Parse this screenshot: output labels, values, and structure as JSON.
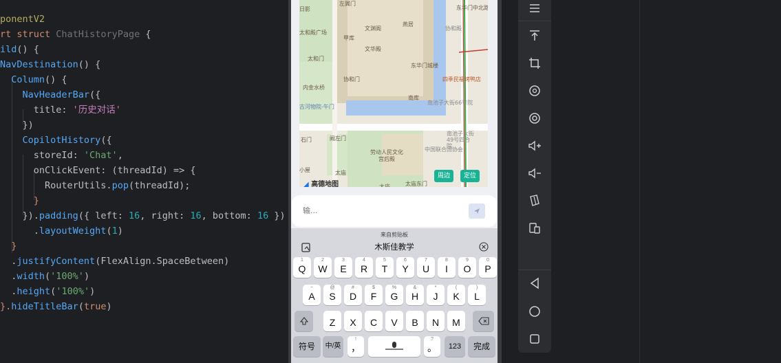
{
  "editor": {
    "lines": [
      [
        {
          "t": "ponentV2",
          "c": "dec"
        }
      ],
      [
        {
          "t": "rt ",
          "c": "kw"
        },
        {
          "t": "struct ",
          "c": "kw"
        },
        {
          "t": "ChatHistoryPage",
          "c": "cls"
        },
        {
          "t": " {",
          "c": "plain"
        }
      ],
      [
        {
          "t": "ild",
          "c": "fn"
        },
        {
          "t": "() {",
          "c": "plain"
        }
      ],
      [
        {
          "t": "NavDestination",
          "c": "fn"
        },
        {
          "t": "() {",
          "c": "plain"
        }
      ],
      [
        {
          "t": "  Column",
          "c": "fn"
        },
        {
          "t": "() {",
          "c": "plain"
        }
      ],
      [
        {
          "t": "    NavHeaderBar",
          "c": "fn"
        },
        {
          "t": "({",
          "c": "plain"
        }
      ],
      [
        {
          "t": "      title: ",
          "c": "plain"
        },
        {
          "t": "'历史对话'",
          "c": "strp"
        }
      ],
      [
        {
          "t": "    })",
          "c": "plain"
        }
      ],
      [
        {
          "t": "    CopilotHistory",
          "c": "fn"
        },
        {
          "t": "({",
          "c": "plain"
        }
      ],
      [
        {
          "t": "      storeId: ",
          "c": "plain"
        },
        {
          "t": "'Chat'",
          "c": "str"
        },
        {
          "t": ",",
          "c": "plain"
        }
      ],
      [
        {
          "t": "      onClickEvent: (",
          "c": "plain"
        },
        {
          "t": "threadId",
          "c": "plain"
        },
        {
          "t": ") => {",
          "c": "plain"
        }
      ],
      [
        {
          "t": "        RouterUtils.",
          "c": "plain"
        },
        {
          "t": "pop",
          "c": "fn"
        },
        {
          "t": "(threadId);",
          "c": "plain"
        }
      ],
      [
        {
          "t": "      }",
          "c": "kw"
        }
      ],
      [
        {
          "t": "    }).",
          "c": "plain"
        },
        {
          "t": "padding",
          "c": "fn"
        },
        {
          "t": "({ left: ",
          "c": "plain"
        },
        {
          "t": "16",
          "c": "num"
        },
        {
          "t": ", right: ",
          "c": "plain"
        },
        {
          "t": "16",
          "c": "num"
        },
        {
          "t": ", bottom: ",
          "c": "plain"
        },
        {
          "t": "16",
          "c": "num"
        },
        {
          "t": " })",
          "c": "plain"
        }
      ],
      [
        {
          "t": "      .",
          "c": "plain"
        },
        {
          "t": "layoutWeight",
          "c": "fn"
        },
        {
          "t": "(",
          "c": "plain"
        },
        {
          "t": "1",
          "c": "num"
        },
        {
          "t": ")",
          "c": "plain"
        }
      ],
      [
        {
          "t": "  }",
          "c": "kw"
        }
      ],
      [
        {
          "t": "  .",
          "c": "plain"
        },
        {
          "t": "justifyContent",
          "c": "fn"
        },
        {
          "t": "(FlexAlign.SpaceBetween)",
          "c": "plain"
        }
      ],
      [
        {
          "t": "  .",
          "c": "plain"
        },
        {
          "t": "width",
          "c": "fn"
        },
        {
          "t": "(",
          "c": "plain"
        },
        {
          "t": "'100%'",
          "c": "str"
        },
        {
          "t": ")",
          "c": "plain"
        }
      ],
      [
        {
          "t": "  .",
          "c": "plain"
        },
        {
          "t": "height",
          "c": "fn"
        },
        {
          "t": "(",
          "c": "plain"
        },
        {
          "t": "'100%'",
          "c": "str"
        },
        {
          "t": ")",
          "c": "plain"
        }
      ],
      [
        {
          "t": "}.",
          "c": "kw"
        },
        {
          "t": "hideTitleBar",
          "c": "fn"
        },
        {
          "t": "(",
          "c": "plain"
        },
        {
          "t": "true",
          "c": "kw"
        },
        {
          "t": ")",
          "c": "plain"
        }
      ]
    ]
  },
  "map": {
    "labels": {
      "l1": "东华门中北路",
      "l2": "文渊阁",
      "l3": "太和殿广场",
      "l4": "甲库",
      "l5": "文华殿",
      "l6": "太和门",
      "l7": "协和门",
      "l8": "内金水桥",
      "l9": "东华门城楼",
      "l10": "南库",
      "l11": "四季民福烤鸭店",
      "l12": "南池子大街66号院",
      "l13": "古河物院-午门",
      "l14": "南池子大街49号四合院",
      "l15": "石门",
      "l16": "阙左门",
      "l17": "劳动人民文化宫后殿",
      "l18": "中国联合国协会",
      "l19": "小屋",
      "l20": "太庙",
      "l21": "大庙",
      "l22": "太庙东门",
      "l23": "左翼门",
      "l24": "协和殿",
      "l25": "燕居",
      "l26": "日影"
    },
    "logo": "高德地图",
    "btn_nearby": "周边",
    "btn_locate": "定位"
  },
  "chat": {
    "placeholder": "输...",
    "send_icon": "send-icon"
  },
  "keyboard": {
    "clip_source": "来自剪贴板",
    "clip_text": "木斯佳教学",
    "row1": [
      {
        "k": "Q",
        "s": "1"
      },
      {
        "k": "W",
        "s": "2"
      },
      {
        "k": "E",
        "s": "3"
      },
      {
        "k": "R",
        "s": "4"
      },
      {
        "k": "T",
        "s": "5"
      },
      {
        "k": "Y",
        "s": "6"
      },
      {
        "k": "U",
        "s": "7"
      },
      {
        "k": "I",
        "s": "8"
      },
      {
        "k": "O",
        "s": "9"
      },
      {
        "k": "P",
        "s": "0"
      }
    ],
    "row2": [
      {
        "k": "A",
        "s": "~"
      },
      {
        "k": "S",
        "s": "@"
      },
      {
        "k": "D",
        "s": "#"
      },
      {
        "k": "F",
        "s": "$"
      },
      {
        "k": "G",
        "s": "%"
      },
      {
        "k": "H",
        "s": "&"
      },
      {
        "k": "J",
        "s": "*"
      },
      {
        "k": "K",
        "s": "("
      },
      {
        "k": "L",
        "s": ")"
      }
    ],
    "row3": [
      {
        "k": "Z",
        "s": ""
      },
      {
        "k": "X",
        "s": ""
      },
      {
        "k": "C",
        "s": ""
      },
      {
        "k": "V",
        "s": ""
      },
      {
        "k": "B",
        "s": ""
      },
      {
        "k": "N",
        "s": ""
      },
      {
        "k": "M",
        "s": ""
      }
    ],
    "symbols": "符号",
    "lang": "中/英",
    "comma": "，",
    "comma_sub": "!",
    "period": "。",
    "period_sub": "?",
    "num": "123",
    "done": "完成"
  },
  "colors": {
    "accent": "#18b396",
    "editor_bg": "#1e1f22",
    "toolbar_bg": "#2b2d30"
  }
}
